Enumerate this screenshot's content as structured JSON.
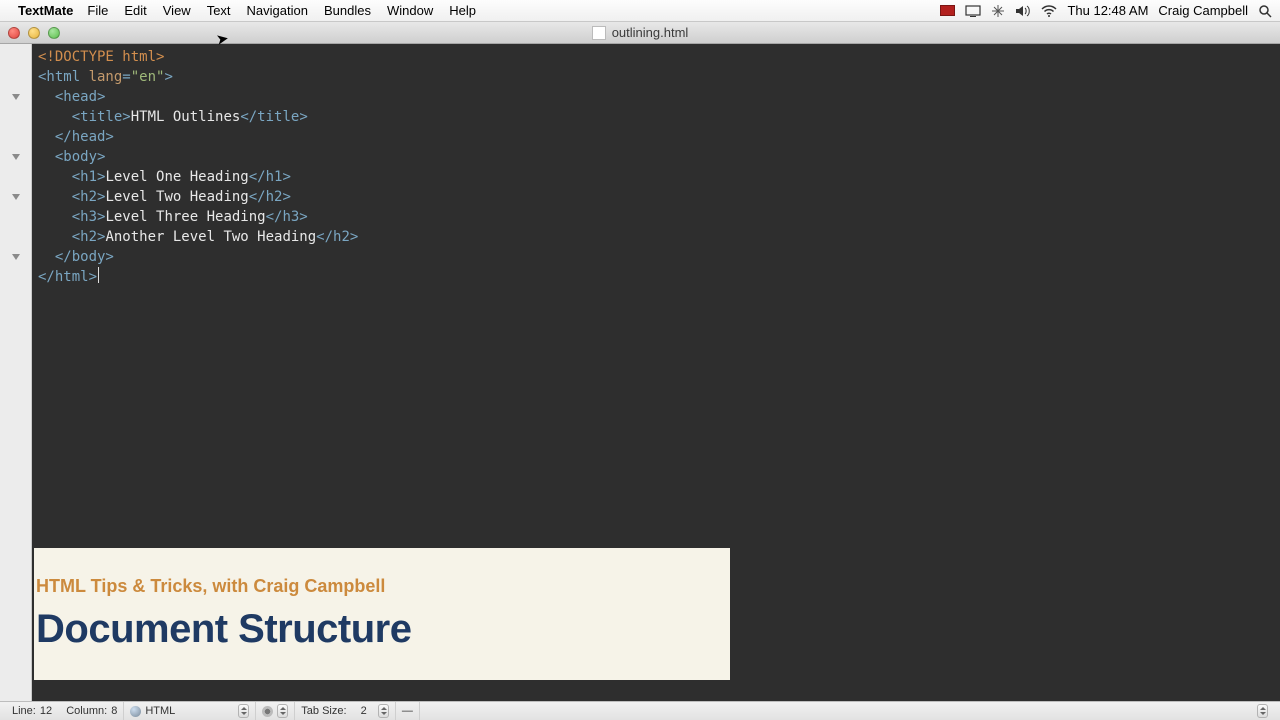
{
  "menubar": {
    "app": "TextMate",
    "items": [
      "File",
      "Edit",
      "View",
      "Text",
      "Navigation",
      "Bundles",
      "Window",
      "Help"
    ],
    "clock": "Thu 12:48 AM",
    "user": "Craig Campbell"
  },
  "window": {
    "title": "outlining.html"
  },
  "code": {
    "lines": [
      [
        {
          "c": "decl",
          "t": "<!DOCTYPE html>"
        }
      ],
      [
        {
          "c": "tag",
          "t": "<html "
        },
        {
          "c": "attr",
          "t": "lang"
        },
        {
          "c": "tag",
          "t": "="
        },
        {
          "c": "str",
          "t": "\"en\""
        },
        {
          "c": "tag",
          "t": ">"
        }
      ],
      [
        {
          "c": "text",
          "t": "  "
        },
        {
          "c": "tag",
          "t": "<head>"
        }
      ],
      [
        {
          "c": "text",
          "t": "    "
        },
        {
          "c": "tag",
          "t": "<title>"
        },
        {
          "c": "text",
          "t": "HTML Outlines"
        },
        {
          "c": "tag",
          "t": "</title>"
        }
      ],
      [
        {
          "c": "text",
          "t": "  "
        },
        {
          "c": "tag",
          "t": "</head>"
        }
      ],
      [
        {
          "c": "text",
          "t": "  "
        },
        {
          "c": "tag",
          "t": "<body>"
        }
      ],
      [
        {
          "c": "text",
          "t": "    "
        },
        {
          "c": "tag",
          "t": "<h1>"
        },
        {
          "c": "text",
          "t": "Level One Heading"
        },
        {
          "c": "tag",
          "t": "</h1>"
        }
      ],
      [
        {
          "c": "text",
          "t": "    "
        },
        {
          "c": "tag",
          "t": "<h2>"
        },
        {
          "c": "text",
          "t": "Level Two Heading"
        },
        {
          "c": "tag",
          "t": "</h2>"
        }
      ],
      [
        {
          "c": "text",
          "t": "    "
        },
        {
          "c": "tag",
          "t": "<h3>"
        },
        {
          "c": "text",
          "t": "Level Three Heading"
        },
        {
          "c": "tag",
          "t": "</h3>"
        }
      ],
      [
        {
          "c": "text",
          "t": "    "
        },
        {
          "c": "tag",
          "t": "<h2>"
        },
        {
          "c": "text",
          "t": "Another Level Two Heading"
        },
        {
          "c": "tag",
          "t": "</h2>"
        }
      ],
      [
        {
          "c": "text",
          "t": "  "
        },
        {
          "c": "tag",
          "t": "</body>"
        }
      ],
      [
        {
          "c": "tag",
          "t": "</html>"
        }
      ]
    ],
    "fold_rows": [
      2,
      5,
      7,
      10
    ]
  },
  "overlay": {
    "subtitle": "HTML Tips & Tricks, with  Craig Campbell",
    "title": "Document Structure"
  },
  "statusbar": {
    "line_label": "Line:",
    "line": "12",
    "column_label": "Column:",
    "column": "8",
    "language": "HTML",
    "tabsize_label": "Tab Size:",
    "tabsize": "2",
    "symbol": "—"
  }
}
